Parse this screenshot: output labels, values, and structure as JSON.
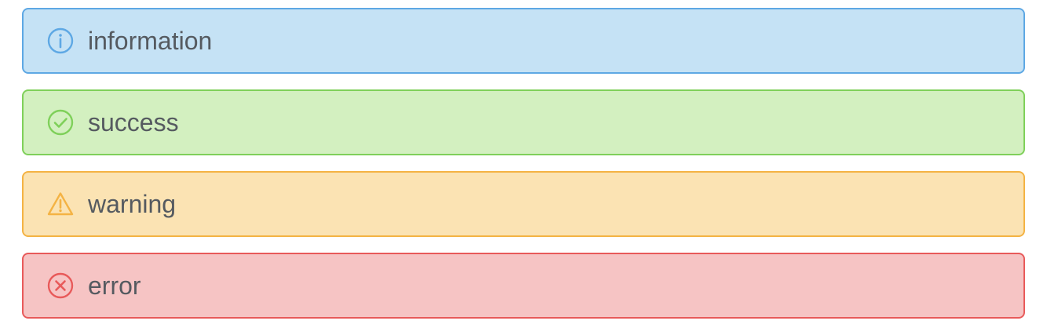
{
  "alerts": [
    {
      "type": "info",
      "icon": "info-circle-icon",
      "message": "information",
      "color": "#5ea8e4",
      "background": "#c5e2f5"
    },
    {
      "type": "success",
      "icon": "check-circle-icon",
      "message": "success",
      "color": "#7fd05a",
      "background": "#d3f0c0"
    },
    {
      "type": "warning",
      "icon": "warning-triangle-icon",
      "message": "warning",
      "color": "#f4b344",
      "background": "#fbe3b3"
    },
    {
      "type": "error",
      "icon": "close-circle-icon",
      "message": "error",
      "color": "#e85a5a",
      "background": "#f6c4c4"
    }
  ]
}
